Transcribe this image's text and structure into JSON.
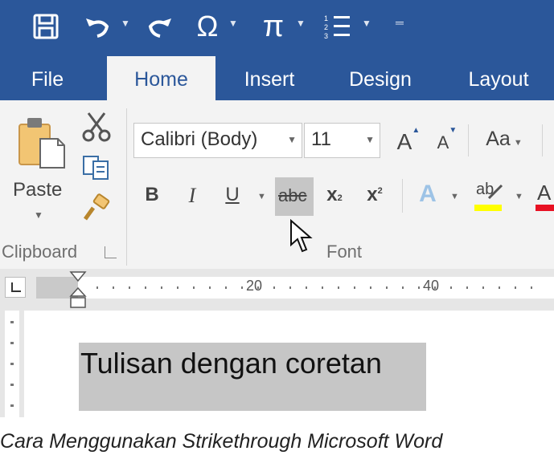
{
  "qat": {
    "icons": [
      "save-icon",
      "undo-icon",
      "redo-icon",
      "omega-symbol-icon",
      "pi-equation-icon",
      "numbered-list-icon",
      "customize-qat-icon"
    ],
    "omega_glyph": "Ω",
    "pi_glyph": "π"
  },
  "tabs": [
    {
      "label": "File"
    },
    {
      "label": "Home"
    },
    {
      "label": "Insert"
    },
    {
      "label": "Design"
    },
    {
      "label": "Layout"
    }
  ],
  "clipboard": {
    "paste_label": "Paste",
    "group_label": "Clipboard"
  },
  "font": {
    "family": "Calibri (Body)",
    "size": "11",
    "grow_label": "A",
    "shrink_label": "A",
    "case_label": "Aa",
    "bold": "B",
    "italic": "I",
    "underline": "U",
    "strike": "abc",
    "subscript": "x",
    "subscript_mark": "2",
    "superscript": "x",
    "superscript_mark": "2",
    "text_effects": "A",
    "highlight": "ab",
    "font_color": "A",
    "group_label": "Font"
  },
  "ruler": {
    "marks": [
      "20",
      "40"
    ]
  },
  "document": {
    "text": "Tulisan dengan coretan"
  },
  "caption": "Cara Menggunakan Strikethrough Microsoft Word",
  "colors": {
    "brand": "#2b579a",
    "ribbon": "#f3f3f3",
    "highlight_yellow": "#ffff00",
    "font_red": "#e81123",
    "selection": "#c6c6c6"
  }
}
